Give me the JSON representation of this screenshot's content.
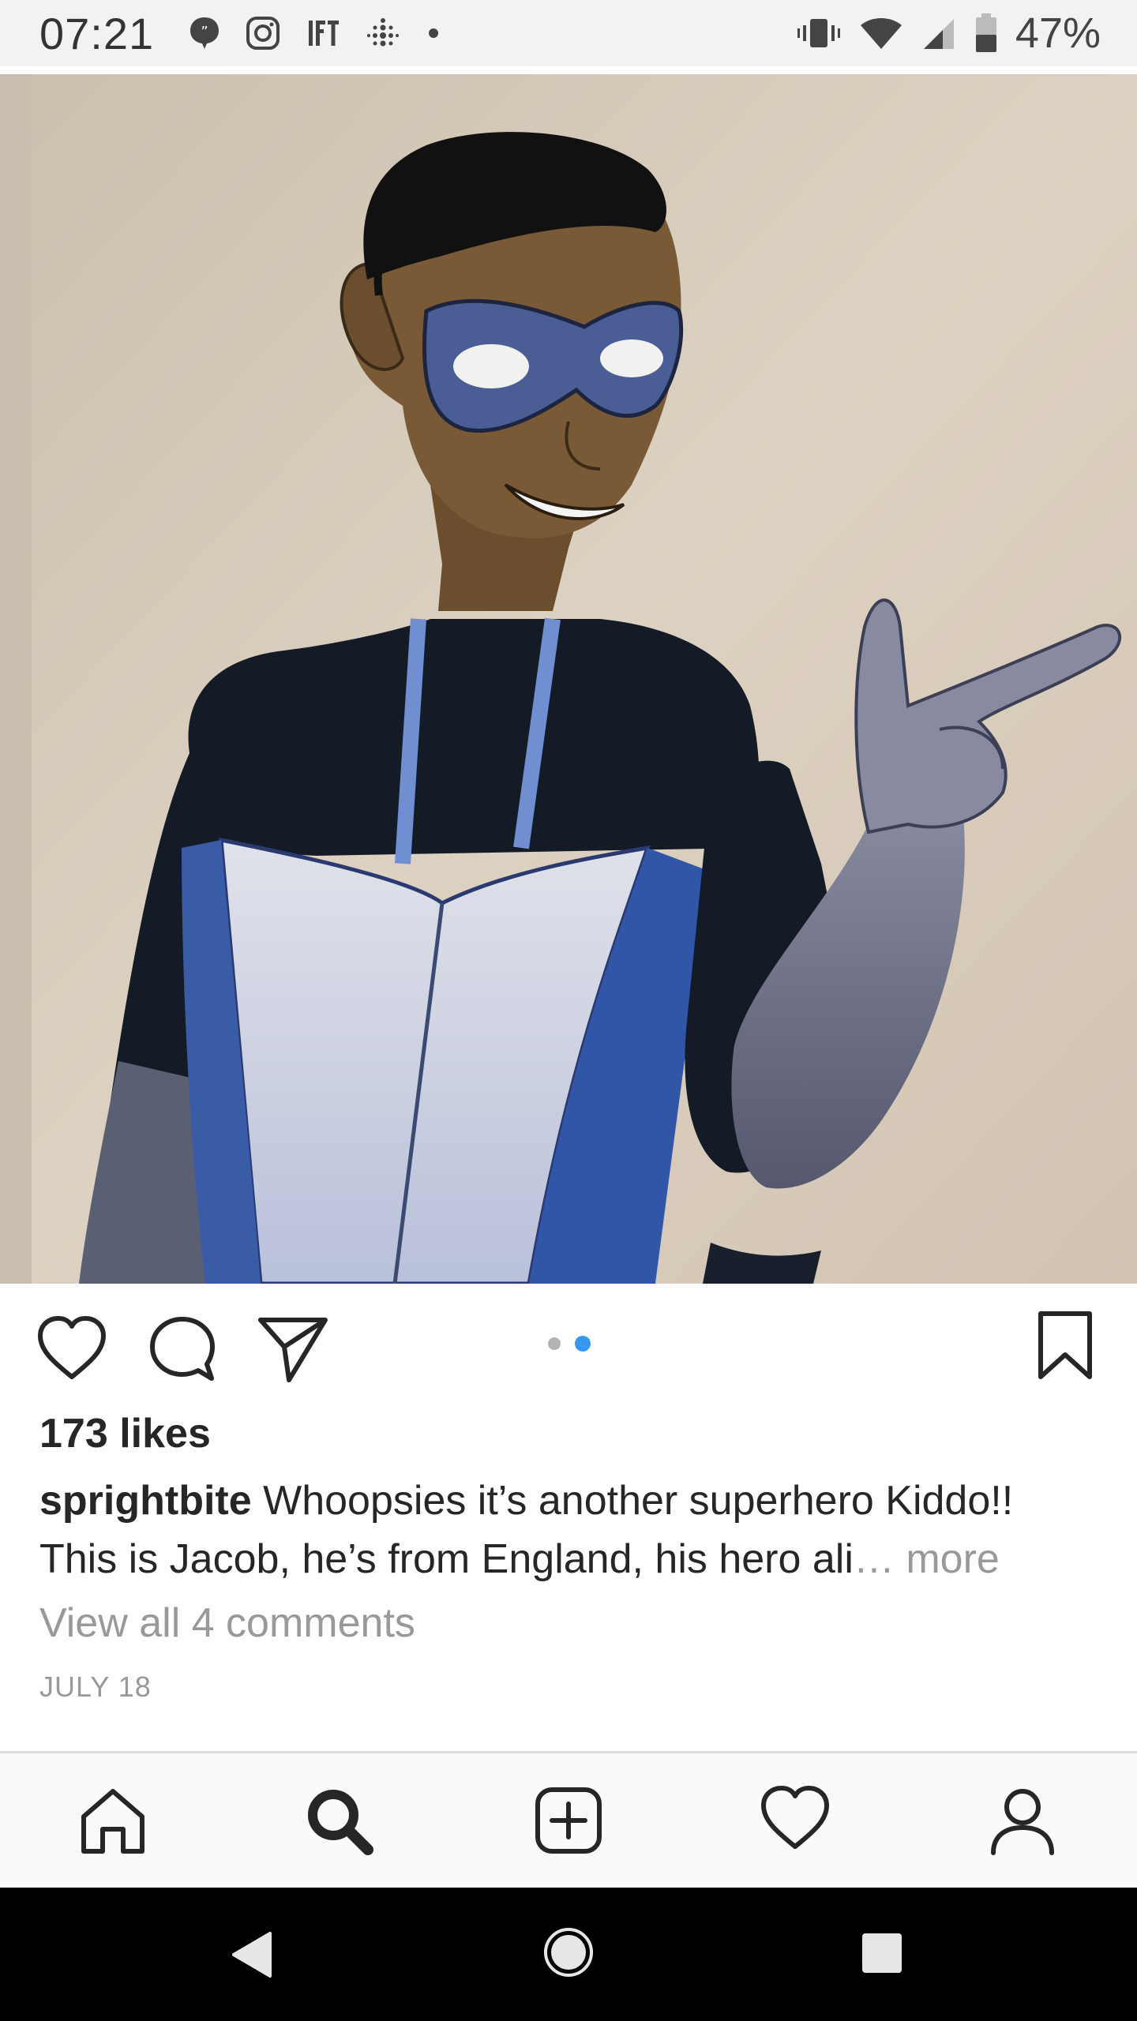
{
  "status_bar": {
    "time": "07:21",
    "left_icons": [
      "message-icon",
      "instagram-icon",
      "ifttt-icon",
      "fitbit-icon",
      "dot-icon"
    ],
    "right_icons": [
      "vibrate-icon",
      "wifi-icon",
      "signal-icon",
      "battery-icon"
    ],
    "battery_text": "47%"
  },
  "post": {
    "image_alt": "watercolor illustration",
    "carousel": {
      "count": 2,
      "active_index": 1
    },
    "actions": [
      "heart-icon",
      "comment-icon",
      "share-icon",
      "bookmark-icon"
    ],
    "likes": "173 likes",
    "caption": {
      "username": "sprightbite",
      "text": "Whoopsies it’s another superhero Kiddo!! This is Jacob, he’s from England, his hero ali",
      "ellipsis": "…",
      "more": "more"
    },
    "comments_link": "View all 4 comments",
    "date": "JULY 18"
  },
  "bottom_nav": {
    "items": [
      "home-icon",
      "search-icon",
      "add-post-icon",
      "activity-heart-icon",
      "profile-icon"
    ],
    "active": "search-icon"
  },
  "android_nav": [
    "back-icon",
    "home-circle-icon",
    "recents-icon"
  ],
  "colors": {
    "accent_blue": "#3897f0",
    "muted_text": "#999999",
    "primary_text": "#262626"
  }
}
